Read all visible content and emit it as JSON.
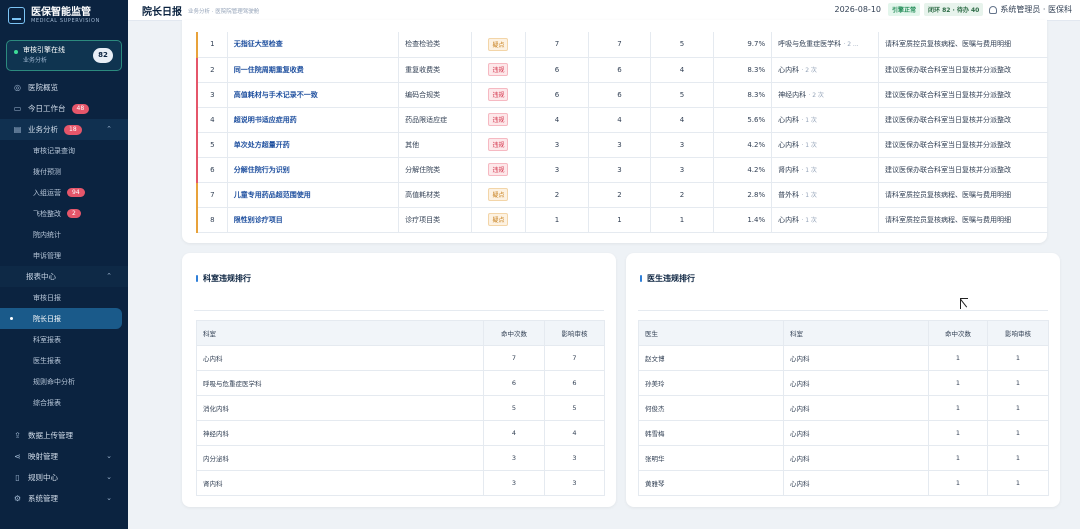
{
  "brand": {
    "title": "医保智能监管",
    "subtitle": "MEDICAL SUPERVISION",
    "icon": "monitor-icon"
  },
  "engine": {
    "title": "审核引擎在线",
    "subtitle": "业务分析",
    "count": "82",
    "status_color": "#3ddc97"
  },
  "nav": {
    "top": [
      {
        "label": "医院概览",
        "icon": "dashboard-icon"
      },
      {
        "label": "今日工作台",
        "icon": "monitor-icon",
        "badge": "48"
      },
      {
        "label": "业务分析",
        "icon": "chart-icon",
        "badge": "18",
        "chevron": "^"
      }
    ],
    "business_sub": [
      {
        "label": "审核记录查询"
      },
      {
        "label": "拨付预测"
      },
      {
        "label": "入组运营",
        "badge": "94"
      },
      {
        "label": "飞检整改",
        "badge": "2"
      },
      {
        "label": "院内统计"
      },
      {
        "label": "申诉管理"
      }
    ],
    "report_group": {
      "label": "报表中心",
      "chevron": "^"
    },
    "report_sub": [
      {
        "label": "审核日报"
      },
      {
        "label": "院长日报"
      },
      {
        "label": "科室报表"
      },
      {
        "label": "医生报表"
      },
      {
        "label": "规则命中分析"
      },
      {
        "label": "综合报表"
      }
    ],
    "bottom": [
      {
        "label": "数据上传管理",
        "icon": "upload-icon"
      },
      {
        "label": "映射管理",
        "icon": "share-icon",
        "chevron": "v"
      },
      {
        "label": "规则中心",
        "icon": "file-icon",
        "chevron": "v"
      },
      {
        "label": "系统管理",
        "icon": "gear-icon",
        "chevron": "v"
      }
    ]
  },
  "topbar": {
    "title": "院长日报",
    "breadcrumb": "业务分析 · 医院院管理驾驶舱",
    "date": "2026-08-10",
    "engine_tag": "引擎正常",
    "stat_tag": "闭环 82 · 待办 40",
    "user": "系统管理员 · 医保科"
  },
  "rules": [
    {
      "no": "1",
      "name": "无指征大型检查",
      "category": "检查检验类",
      "level": "疑点",
      "level_type": "yellow",
      "n1": "7",
      "n2": "7",
      "n3": "5",
      "pct": "9.7%",
      "dept": "呼吸与危重症医学科",
      "dept_sub": "· 2 ...",
      "suggest": "请科室质控员复核病程、医嘱与费用明细"
    },
    {
      "no": "2",
      "name": "同一住院周期重复收费",
      "category": "重复收费类",
      "level": "违规",
      "level_type": "red",
      "n1": "6",
      "n2": "6",
      "n3": "4",
      "pct": "8.3%",
      "dept": "心内科",
      "dept_sub": "· 2 次",
      "suggest": "建议医保办联合科室当日复核并分派整改"
    },
    {
      "no": "3",
      "name": "高值耗材与手术记录不一致",
      "category": "编码合规类",
      "level": "违规",
      "level_type": "red",
      "n1": "6",
      "n2": "6",
      "n3": "5",
      "pct": "8.3%",
      "dept": "神经内科",
      "dept_sub": "· 2 次",
      "suggest": "建议医保办联合科室当日复核并分派整改"
    },
    {
      "no": "4",
      "name": "超说明书适应症用药",
      "category": "药品限适应症",
      "level": "违规",
      "level_type": "red",
      "n1": "4",
      "n2": "4",
      "n3": "4",
      "pct": "5.6%",
      "dept": "心内科",
      "dept_sub": "· 1 次",
      "suggest": "建议医保办联合科室当日复核并分派整改"
    },
    {
      "no": "5",
      "name": "单次处方超量开药",
      "category": "其他",
      "level": "违规",
      "level_type": "red",
      "n1": "3",
      "n2": "3",
      "n3": "3",
      "pct": "4.2%",
      "dept": "心内科",
      "dept_sub": "· 1 次",
      "suggest": "建议医保办联合科室当日复核并分派整改"
    },
    {
      "no": "6",
      "name": "分解住院行为识别",
      "category": "分解住院类",
      "level": "违规",
      "level_type": "red",
      "n1": "3",
      "n2": "3",
      "n3": "3",
      "pct": "4.2%",
      "dept": "肾内科",
      "dept_sub": "· 1 次",
      "suggest": "建议医保办联合科室当日复核并分派整改"
    },
    {
      "no": "7",
      "name": "儿童专用药品超范围使用",
      "category": "高值耗材类",
      "level": "疑点",
      "level_type": "yellow",
      "n1": "2",
      "n2": "2",
      "n3": "2",
      "pct": "2.8%",
      "dept": "普外科",
      "dept_sub": "· 1 次",
      "suggest": "请科室质控员复核病程、医嘱与费用明细"
    },
    {
      "no": "8",
      "name": "限性别诊疗项目",
      "category": "诊疗项目类",
      "level": "疑点",
      "level_type": "yellow",
      "n1": "1",
      "n2": "1",
      "n3": "1",
      "pct": "1.4%",
      "dept": "心内科",
      "dept_sub": "· 1 次",
      "suggest": "请科室质控员复核病程、医嘱与费用明细"
    }
  ],
  "dept_panel": {
    "title": "科室违规排行",
    "headers": [
      "科室",
      "命中次数",
      "影响审核"
    ],
    "rows": [
      [
        "心内科",
        "7",
        "7"
      ],
      [
        "呼吸与危重症医学科",
        "6",
        "6"
      ],
      [
        "消化内科",
        "5",
        "5"
      ],
      [
        "神经内科",
        "4",
        "4"
      ],
      [
        "内分泌科",
        "3",
        "3"
      ],
      [
        "肾内科",
        "3",
        "3"
      ]
    ]
  },
  "doctor_panel": {
    "title": "医生违规排行",
    "headers": [
      "医生",
      "科室",
      "命中次数",
      "影响审核"
    ],
    "rows": [
      [
        "赵文博",
        "心内科",
        "1",
        "1"
      ],
      [
        "孙美玲",
        "心内科",
        "1",
        "1"
      ],
      [
        "何俊杰",
        "心内科",
        "1",
        "1"
      ],
      [
        "韩雪梅",
        "心内科",
        "1",
        "1"
      ],
      [
        "张明华",
        "心内科",
        "1",
        "1"
      ],
      [
        "黄雅琴",
        "心内科",
        "1",
        "1"
      ]
    ]
  }
}
